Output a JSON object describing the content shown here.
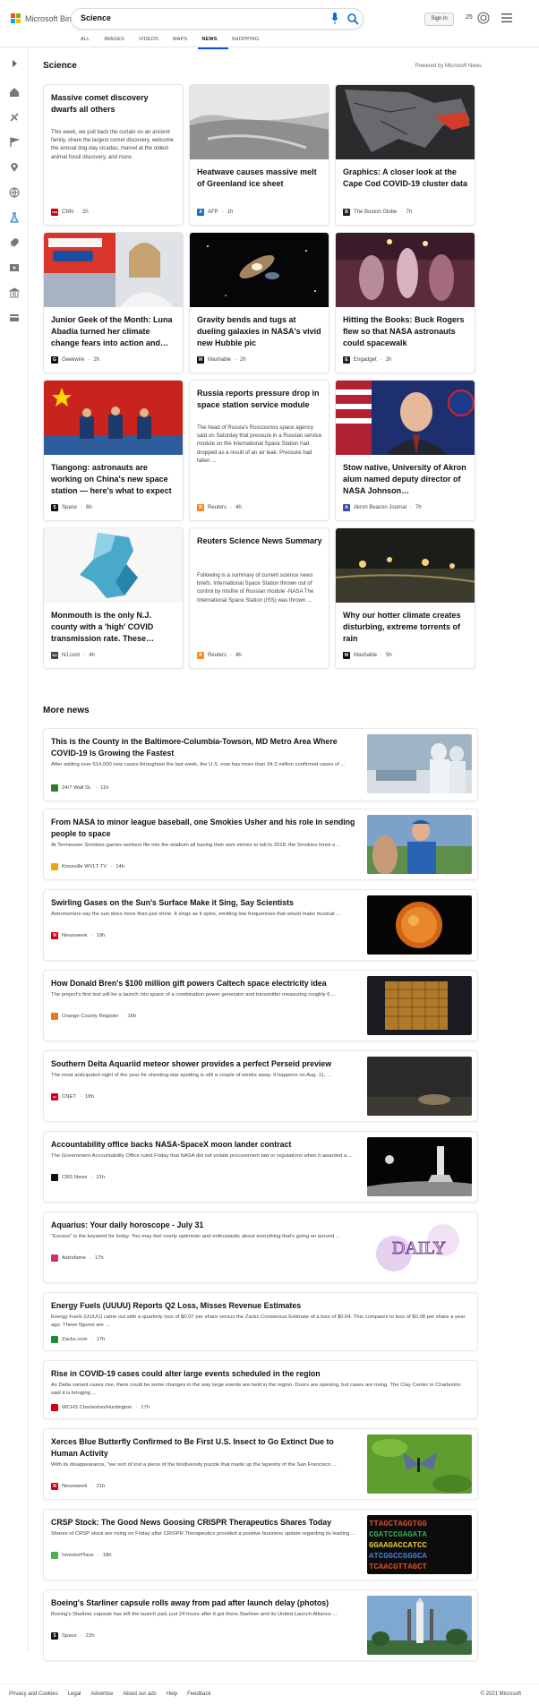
{
  "header": {
    "logo_text": "Microsoft Bing",
    "search_query": "Science",
    "sign_in": "Sign in",
    "points": "25",
    "scopes": [
      "ALL",
      "IMAGES",
      "VIDEOS",
      "MAPS",
      "NEWS",
      "SHOPPING"
    ],
    "active_scope": "NEWS"
  },
  "science": {
    "heading": "Science",
    "powered_by": "Powered by Microsoft News",
    "cards": [
      {
        "title": "Massive comet discovery dwarfs all others",
        "body": "This week, we pull back the curtain on an ancient family, share the largest comet discovery, welcome the annual dog-day cicadas, marvel at the oldest animal fossil discovery, and more.",
        "source": "CNN",
        "time": "2h",
        "logo_color": "#cc0000",
        "logo_letter": "CNN"
      },
      {
        "title": "Heatwave causes massive melt of Greenland ice sheet",
        "body": "",
        "source": "AFP",
        "time": "1h",
        "logo_color": "#1a6ec1",
        "logo_letter": "A"
      },
      {
        "title": "Graphics: A closer look at the Cape Cod COVID-19 cluster data",
        "body": "",
        "source": "The Boston Globe",
        "time": "7h",
        "logo_color": "#222",
        "logo_letter": "B"
      },
      {
        "title": "Junior Geek of the Month: Luna Abadia turned her climate change fears into action and…",
        "body": "",
        "source": "Geekwire",
        "time": "2h",
        "logo_color": "#111",
        "logo_letter": "G"
      },
      {
        "title": "Gravity bends and tugs at dueling galaxies in NASA's vivid new Hubble pic",
        "body": "",
        "source": "Mashable",
        "time": "2h",
        "logo_color": "#111",
        "logo_letter": "M"
      },
      {
        "title": "Hitting the Books: Buck Rogers flew so that NASA astronauts could spacewalk",
        "body": "",
        "source": "Engadget",
        "time": "2h",
        "logo_color": "#222",
        "logo_letter": "E"
      },
      {
        "title": "Tiangong: astronauts are working on China's new space station — here's what to expect",
        "body": "",
        "source": "Space",
        "time": "6h",
        "logo_color": "#111",
        "logo_letter": "S"
      },
      {
        "title": "Russia reports pressure drop in space station service module",
        "body": "The head of Russia's Roscosmos space agency said on Saturday that pressure in a Russian service module on the International Space Station had dropped as a result of an air leak. Pressure had fallen ...",
        "source": "Reuters",
        "time": "4h",
        "logo_color": "#f08a24",
        "logo_letter": "R"
      },
      {
        "title": "Stow native, University of Akron alum named deputy director of NASA Johnson…",
        "body": "",
        "source": "Akron Beacon Journal",
        "time": "7h",
        "logo_color": "#3a4fa0",
        "logo_letter": "A"
      },
      {
        "title": "Monmouth is the only N.J. county with a 'high' COVID transmission rate. These…",
        "body": "",
        "source": "NJ.com",
        "time": "4h",
        "logo_color": "#444",
        "logo_letter": "NJ"
      },
      {
        "title": "Reuters Science News Summary",
        "body": "Following is a summary of current science news briefs. International Space Station thrown out of control by misfire of Russian module -NASA The International Space Station (ISS) was thrown ...",
        "source": "Reuters",
        "time": "4h",
        "logo_color": "#f08a24",
        "logo_letter": "R"
      },
      {
        "title": "Why our hotter climate creates disturbing, extreme torrents of rain",
        "body": "",
        "source": "Mashable",
        "time": "5h",
        "logo_color": "#111",
        "logo_letter": "M"
      }
    ]
  },
  "more_news": {
    "heading": "More news",
    "items": [
      {
        "title": "This is the County in the Baltimore-Columbia-Towson, MD Metro Area Where COVID-19 Is Growing the Fastest",
        "body": "After adding over 514,000 new cases throughout the last week, the U.S. now has more than 34.2 million confirmed cases of ...",
        "source": "24/7 Wall St.",
        "time": "11h",
        "logo_color": "#2d7a2d"
      },
      {
        "title": "From NASA to minor league baseball, one Smokies Usher and his role in sending people to space",
        "body": "At Tennessee Smokies games workers file into the stadium all having their own stories to tell.In 2018, the Smokies hired a ...",
        "source": "Knoxville WVLT-TV",
        "time": "14h",
        "logo_color": "#f2a20c"
      },
      {
        "title": "Swirling Gases on the Sun's Surface Make it Sing, Say Scientists",
        "body": "Astronomers say the sun does more than just shine. It sings as it spins, emitting low frequencies that would make musical ...",
        "source": "Newsweek",
        "time": "19h",
        "logo_color": "#d0021b"
      },
      {
        "title": "How Donald Bren's $100 million gift powers Caltech space electricity idea",
        "body": "The project's first test will be a launch into space of a combination power generator and transmitter measuring roughly 6 ...",
        "source": "Orange County Register",
        "time": "16h",
        "logo_color": "#e87722"
      },
      {
        "title": "Southern Delta Aquariid meteor shower provides a perfect Perseid preview",
        "body": "The most anticipated night of the year for shooting-star spotting is still a couple of weeks away. It happens on Aug. 11, ...",
        "source": "CNET",
        "time": "18h",
        "logo_color": "#d0021b"
      },
      {
        "title": "Accountability office backs NASA-SpaceX moon lander contract",
        "body": "The Government Accountability Office ruled Friday that NASA did not violate procurement law or regulations when it awarded a ...",
        "source": "CBS News",
        "time": "21h",
        "logo_color": "#111"
      },
      {
        "title": "Aquarius: Your daily horoscope - July 31",
        "body": "\"Excess\" is the keyword for today. You may feel overly optimistic and enthusiastic about everything that's going on around ...",
        "source": "Astrofame",
        "time": "17h",
        "logo_color": "#c9356b"
      },
      {
        "title": "Energy Fuels (UUUU) Reports Q2 Loss, Misses Revenue Estimates",
        "body": "Energy Fuels (UUUU) came out with a quarterly loss of $0.07 per share versus the Zacks Consensus Estimate of a loss of $0.04. This compares to loss of $0.08 per share a year ago. These figures are ...",
        "source": "Zacks.com",
        "time": "17h",
        "logo_color": "#1f8c3b"
      },
      {
        "title": "Rise in COVID-19 cases could alter large events scheduled in the region",
        "body": "As Delta variant cases rise, there could be some changes in the way large events are held in the region. Doors are opening, but cases are rising. The Clay Center in Charleston said it is bringing ...",
        "source": "WCHS Charleston/Huntington",
        "time": "17h",
        "logo_color": "#d0021b"
      },
      {
        "title": "Xerces Blue Butterfly Confirmed to Be First U.S. Insect to Go Extinct Due to Human Activity",
        "body": "With its disappearance, \"we sort of lost a piece of the biodiversity puzzle that made up the tapestry of the San Francisco ...",
        "source": "Newsweek",
        "time": "21h",
        "logo_color": "#d0021b"
      },
      {
        "title": "CRSP Stock: The Good News Goosing CRISPR Therapeutics Shares Today",
        "body": "Shares of CRSP stock are rising on Friday after CRISPR Therapeutics provided a positive business update regarding its leading ...",
        "source": "InvestorPlace",
        "time": "18h",
        "logo_color": "#4caf50"
      },
      {
        "title": "Boeing's Starliner capsule rolls away from pad after launch delay (photos)",
        "body": "Boeing's Starliner capsule has left the launch pad, just 24 hours after it got there.Starliner and its United Launch Alliance ...",
        "source": "Space",
        "time": "22h",
        "logo_color": "#111"
      }
    ]
  },
  "footer": {
    "links": [
      "Privacy and Cookies",
      "Legal",
      "Advertise",
      "About our ads",
      "Help",
      "Feedback"
    ],
    "copyright": "© 2021 Microsoft"
  }
}
